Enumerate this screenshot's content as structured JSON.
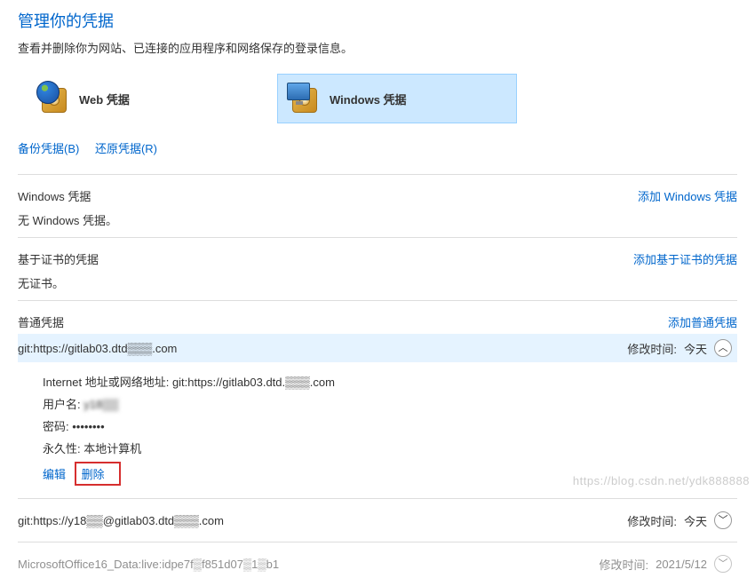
{
  "header": {
    "title": "管理你的凭据",
    "subtitle": "查看并删除你为网站、已连接的应用程序和网络保存的登录信息。"
  },
  "tabs": {
    "web": "Web 凭据",
    "windows": "Windows 凭据"
  },
  "backup_restore": {
    "backup": "备份凭据(B)",
    "restore": "还原凭据(R)"
  },
  "sections": {
    "windows": {
      "title": "Windows 凭据",
      "add_link": "添加 Windows 凭据",
      "empty": "无 Windows 凭据。"
    },
    "cert": {
      "title": "基于证书的凭据",
      "add_link": "添加基于证书的凭据",
      "empty": "无证书。"
    },
    "generic": {
      "title": "普通凭据",
      "add_link": "添加普通凭据"
    }
  },
  "credentials": [
    {
      "name": "git:https://gitlab03.dtd▒▒▒.com",
      "modified_label": "修改时间:",
      "modified_value": "今天",
      "expanded": true,
      "details": {
        "address_label": "Internet 地址或网络地址:",
        "address_value": "git:https://gitlab03.dtd.▒▒▒.com",
        "user_label": "用户名:",
        "user_value": "y18▒▒",
        "password_label": "密码:",
        "password_value": "••••••••",
        "persist_label": "永久性:",
        "persist_value": "本地计算机",
        "edit": "编辑",
        "delete": "删除"
      }
    },
    {
      "name": "git:https://y18▒▒@gitlab03.dtd▒▒▒.com",
      "modified_label": "修改时间:",
      "modified_value": "今天",
      "expanded": false
    },
    {
      "name": "MicrosoftOffice16_Data:live:idpe7f▒f851d07▒1▒b1",
      "modified_label": "修改时间:",
      "modified_value": "2021/5/12",
      "expanded": false
    }
  ],
  "watermark": "https://blog.csdn.net/ydk888888"
}
